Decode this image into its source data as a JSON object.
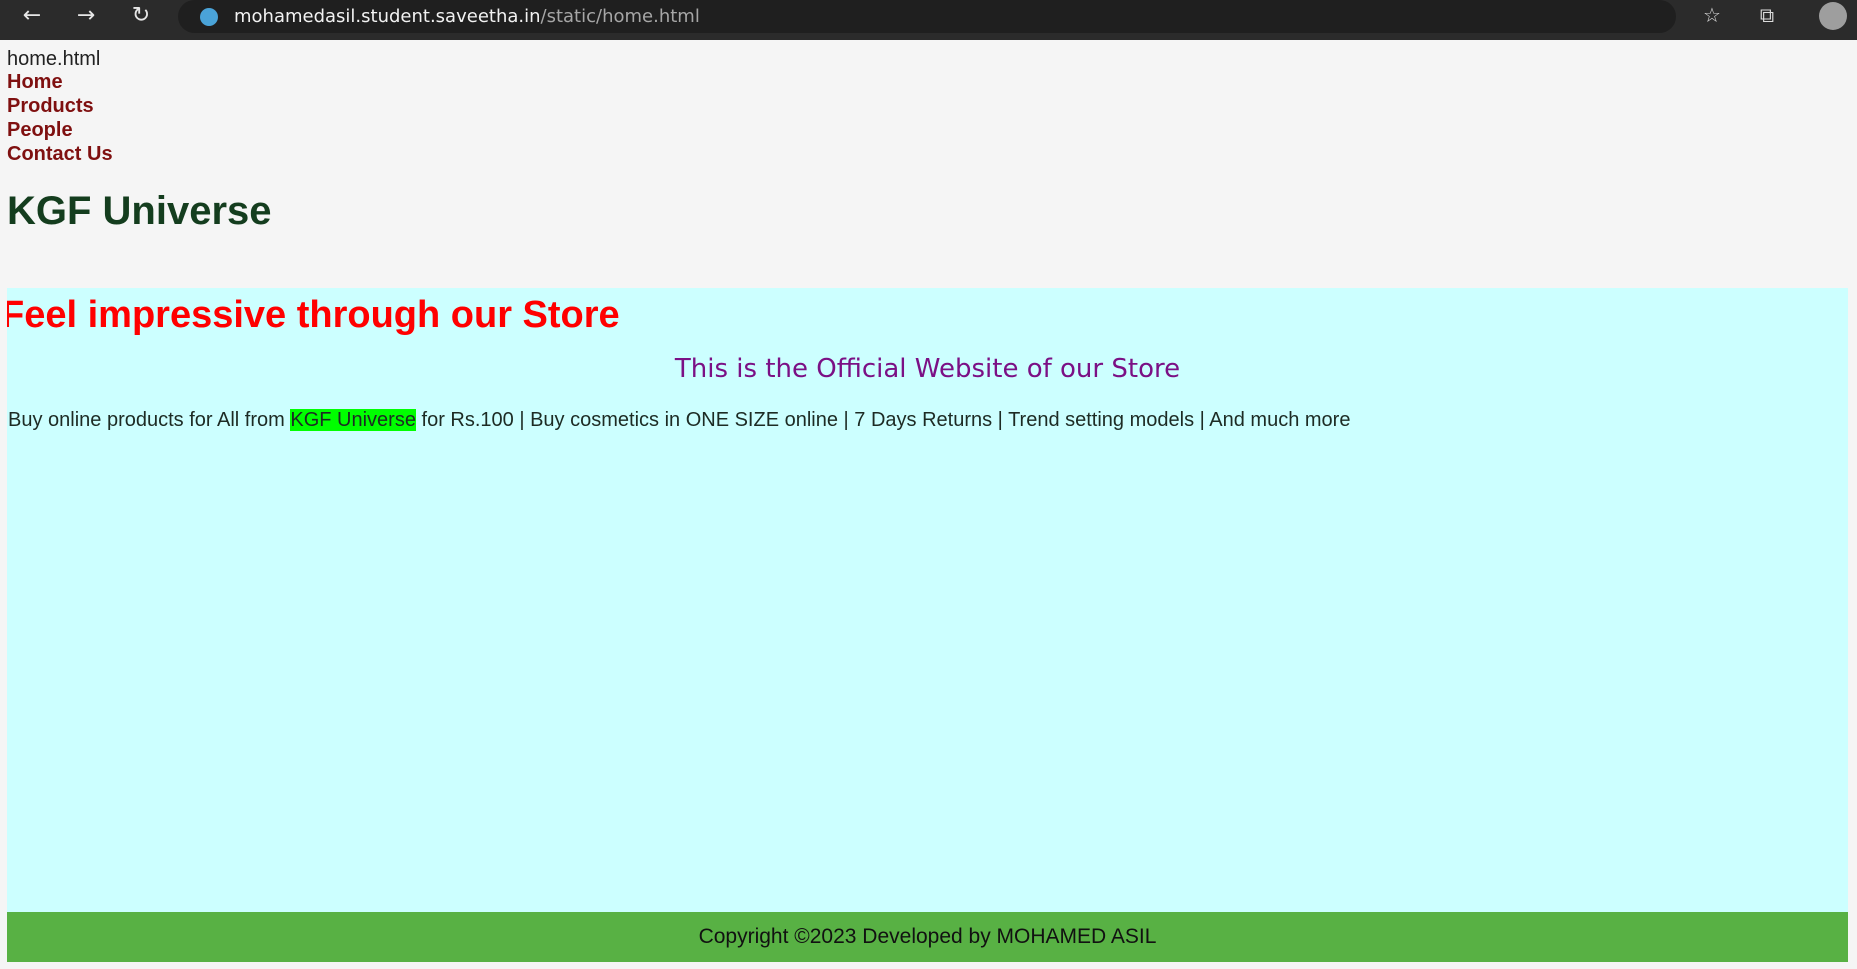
{
  "browser": {
    "url_host": "mohamedasil.student.saveetha.in",
    "url_path": "/static/home.html"
  },
  "page": {
    "file_label": "home.html",
    "nav": [
      "Home",
      "Products",
      "People",
      "Contact Us"
    ],
    "title": "KGF Universe",
    "marquee_text": "Feel impressive through our Store",
    "official_text": "This is the Official Website of our Store",
    "tagline": {
      "before": "Buy online products for All from ",
      "highlight": "KGF Universe",
      "after": " for Rs.100 | Buy cosmetics in ONE SIZE online | 7 Days Returns | Trend setting models | And much more"
    },
    "footer": "Copyright ©2023 Developed by MOHAMED ASIL"
  },
  "colors": {
    "content_bg": "#ccffff",
    "marquee": "#ff0000",
    "highlight": "#00ff00",
    "footer_bg": "#58b144",
    "nav_link": "#7f1010"
  },
  "icons": [
    "back-icon",
    "forward-icon",
    "reload-icon",
    "site-icon",
    "favorites-icon",
    "collections-icon",
    "profile-icon"
  ]
}
